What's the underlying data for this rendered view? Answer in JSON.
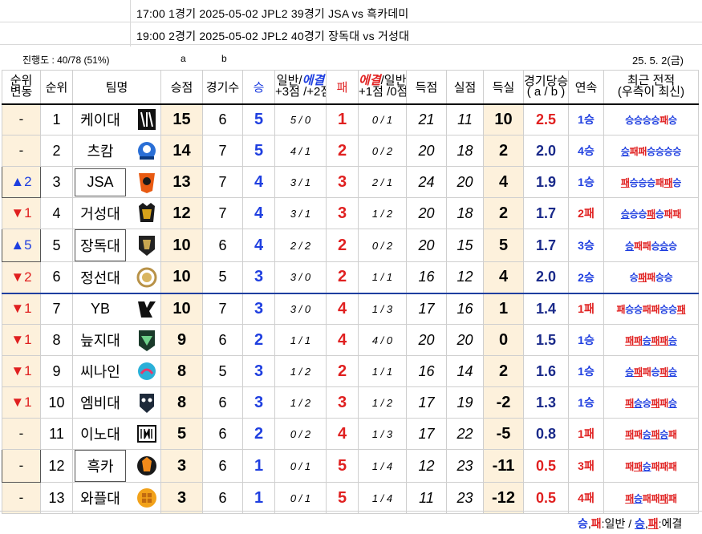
{
  "schedule": [
    {
      "text": "17:00 1경기   2025-05-02 JPL2  39경기 JSA vs 흑카데미"
    },
    {
      "text": "19:00 2경기   2025-05-02 JPL2  40경기 장독대 vs 거성대"
    }
  ],
  "progress": "진행도 : 40/78 (51%)",
  "col_a": "a",
  "col_b": "b",
  "date": "25. 5. 2(금)",
  "headers": {
    "change": [
      "순위",
      "변동"
    ],
    "rank": "순위",
    "team": "팀명",
    "points": "승점",
    "games": "경기수",
    "wins": "승",
    "win_split": {
      "normal": "일반/",
      "ext": "에결",
      "pts": "+3점 /+2점"
    },
    "losses": "패",
    "loss_split": {
      "ext": "에결",
      "normal": "/일반",
      "pts": "+1점 /0점"
    },
    "gf": "득점",
    "ga": "실점",
    "gd": "득실",
    "rate": [
      "경기당승점",
      "( a / b )"
    ],
    "streak": "연속",
    "recent": [
      "최근 전적",
      "(우측이 최신)"
    ]
  },
  "rows": [
    {
      "change": "-",
      "dir": "none",
      "rank": "1",
      "team": "케이대",
      "logo": "logo-keidae",
      "pts": "15",
      "gp": "6",
      "w": "5",
      "wsplit": "5 / 0",
      "l": "1",
      "lsplit": "0 / 1",
      "gf": "21",
      "ga": "11",
      "gd": "10",
      "rate": "2.5",
      "rate_color": "red",
      "streak": "1승",
      "streak_type": "win",
      "recent": [
        [
          "승",
          "w",
          0
        ],
        [
          "승",
          "w",
          0
        ],
        [
          "승",
          "w",
          0
        ],
        [
          "승",
          "w",
          0
        ],
        [
          "패",
          "l",
          0
        ],
        [
          "승",
          "w",
          0
        ]
      ]
    },
    {
      "change": "-",
      "dir": "none",
      "rank": "2",
      "team": "츠캄",
      "logo": "logo-tscam",
      "pts": "14",
      "gp": "7",
      "w": "5",
      "wsplit": "4 / 1",
      "l": "2",
      "lsplit": "0 / 2",
      "gf": "20",
      "ga": "18",
      "gd": "2",
      "rate": "2.0",
      "rate_color": "blue",
      "streak": "4승",
      "streak_type": "win",
      "recent": [
        [
          "승",
          "w",
          1
        ],
        [
          "패",
          "l",
          0
        ],
        [
          "패",
          "l",
          0
        ],
        [
          "승",
          "w",
          0
        ],
        [
          "승",
          "w",
          0
        ],
        [
          "승",
          "w",
          0
        ],
        [
          "승",
          "w",
          0
        ]
      ]
    },
    {
      "change": "▲2",
      "dir": "up",
      "boxed": true,
      "rank": "3",
      "team": "JSA",
      "team_boxed": true,
      "logo": "logo-jsa",
      "pts": "13",
      "gp": "7",
      "w": "4",
      "wsplit": "3 / 1",
      "l": "3",
      "lsplit": "2 / 1",
      "gf": "24",
      "ga": "20",
      "gd": "4",
      "rate": "1.9",
      "rate_color": "blue",
      "streak": "1승",
      "streak_type": "win",
      "recent": [
        [
          "패",
          "l",
          1
        ],
        [
          "승",
          "w",
          0
        ],
        [
          "승",
          "w",
          0
        ],
        [
          "승",
          "w",
          0
        ],
        [
          "패",
          "l",
          0
        ],
        [
          "패",
          "l",
          1
        ],
        [
          "승",
          "w",
          0
        ]
      ]
    },
    {
      "change": "▼1",
      "dir": "down",
      "rank": "4",
      "team": "거성대",
      "logo": "logo-geosung",
      "pts": "12",
      "gp": "7",
      "w": "4",
      "wsplit": "3 / 1",
      "l": "3",
      "lsplit": "1 / 2",
      "gf": "20",
      "ga": "18",
      "gd": "2",
      "rate": "1.7",
      "rate_color": "blue",
      "streak": "2패",
      "streak_type": "loss",
      "recent": [
        [
          "승",
          "w",
          1
        ],
        [
          "승",
          "w",
          0
        ],
        [
          "승",
          "w",
          0
        ],
        [
          "패",
          "l",
          1
        ],
        [
          "승",
          "w",
          0
        ],
        [
          "패",
          "l",
          0
        ],
        [
          "패",
          "l",
          0
        ]
      ]
    },
    {
      "change": "▲5",
      "dir": "up",
      "boxed": true,
      "rank": "5",
      "team": "장독대",
      "team_boxed": true,
      "logo": "logo-jangdok",
      "pts": "10",
      "gp": "6",
      "w": "4",
      "wsplit": "2 / 2",
      "l": "2",
      "lsplit": "0 / 2",
      "gf": "20",
      "ga": "15",
      "gd": "5",
      "rate": "1.7",
      "rate_color": "blue",
      "streak": "3승",
      "streak_type": "win",
      "recent": [
        [
          "승",
          "w",
          1
        ],
        [
          "패",
          "l",
          0
        ],
        [
          "패",
          "l",
          0
        ],
        [
          "승",
          "w",
          0
        ],
        [
          "승",
          "w",
          1
        ],
        [
          "승",
          "w",
          0
        ]
      ]
    },
    {
      "change": "▼2",
      "dir": "down",
      "rank": "6",
      "team": "정선대",
      "logo": "logo-jungsun",
      "pts": "10",
      "gp": "5",
      "w": "3",
      "wsplit": "3 / 0",
      "l": "2",
      "lsplit": "1 / 1",
      "gf": "16",
      "ga": "12",
      "gd": "4",
      "rate": "2.0",
      "rate_color": "blue",
      "streak": "2승",
      "streak_type": "win",
      "split": true,
      "recent": [
        [
          "승",
          "w",
          0
        ],
        [
          "패",
          "l",
          1
        ],
        [
          "패",
          "l",
          0
        ],
        [
          "승",
          "w",
          0
        ],
        [
          "승",
          "w",
          0
        ]
      ]
    },
    {
      "change": "▼1",
      "dir": "down",
      "rank": "7",
      "team": "YB",
      "logo": "logo-yb",
      "pts": "10",
      "gp": "7",
      "w": "3",
      "wsplit": "3 / 0",
      "l": "4",
      "lsplit": "1 / 3",
      "gf": "17",
      "ga": "16",
      "gd": "1",
      "rate": "1.4",
      "rate_color": "blue",
      "streak": "1패",
      "streak_type": "loss",
      "recent": [
        [
          "패",
          "l",
          0
        ],
        [
          "승",
          "w",
          0
        ],
        [
          "승",
          "w",
          0
        ],
        [
          "패",
          "l",
          0
        ],
        [
          "패",
          "l",
          0
        ],
        [
          "승",
          "w",
          0
        ],
        [
          "승",
          "w",
          0
        ],
        [
          "패",
          "l",
          1
        ]
      ]
    },
    {
      "change": "▼1",
      "dir": "down",
      "rank": "8",
      "team": "늪지대",
      "logo": "logo-neupji",
      "pts": "9",
      "gp": "6",
      "w": "2",
      "wsplit": "1 / 1",
      "l": "4",
      "lsplit": "4 / 0",
      "gf": "20",
      "ga": "20",
      "gd": "0",
      "rate": "1.5",
      "rate_color": "blue",
      "streak": "1승",
      "streak_type": "win",
      "recent": [
        [
          "패",
          "l",
          1
        ],
        [
          "패",
          "l",
          1
        ],
        [
          "승",
          "w",
          1
        ],
        [
          "패",
          "l",
          1
        ],
        [
          "패",
          "l",
          1
        ],
        [
          "승",
          "w",
          1
        ]
      ]
    },
    {
      "change": "▼1",
      "dir": "down",
      "rank": "9",
      "team": "씨나인",
      "logo": "logo-c9",
      "pts": "8",
      "gp": "5",
      "w": "3",
      "wsplit": "1 / 2",
      "l": "2",
      "lsplit": "1 / 1",
      "gf": "16",
      "ga": "14",
      "gd": "2",
      "rate": "1.6",
      "rate_color": "blue",
      "streak": "1승",
      "streak_type": "win",
      "recent": [
        [
          "승",
          "w",
          1
        ],
        [
          "패",
          "l",
          1
        ],
        [
          "패",
          "l",
          0
        ],
        [
          "승",
          "w",
          0
        ],
        [
          "패",
          "l",
          1
        ],
        [
          "승",
          "w",
          1
        ]
      ]
    },
    {
      "change": "▼1",
      "dir": "down",
      "rank": "10",
      "team": "엠비대",
      "logo": "logo-mbi",
      "pts": "8",
      "gp": "6",
      "w": "3",
      "wsplit": "1 / 2",
      "l": "3",
      "lsplit": "1 / 2",
      "gf": "17",
      "ga": "19",
      "gd": "-2",
      "rate": "1.3",
      "rate_color": "blue",
      "streak": "1승",
      "streak_type": "win",
      "recent": [
        [
          "패",
          "l",
          1
        ],
        [
          "승",
          "w",
          1
        ],
        [
          "승",
          "w",
          0
        ],
        [
          "패",
          "l",
          1
        ],
        [
          "패",
          "l",
          0
        ],
        [
          "승",
          "w",
          1
        ]
      ]
    },
    {
      "change": "-",
      "dir": "none",
      "rank": "11",
      "team": "이노대",
      "logo": "logo-ino",
      "pts": "5",
      "gp": "6",
      "w": "2",
      "wsplit": "0 / 2",
      "l": "4",
      "lsplit": "1 / 3",
      "gf": "17",
      "ga": "22",
      "gd": "-5",
      "rate": "0.8",
      "rate_color": "blue",
      "streak": "1패",
      "streak_type": "loss",
      "recent": [
        [
          "패",
          "l",
          1
        ],
        [
          "패",
          "l",
          0
        ],
        [
          "승",
          "w",
          1
        ],
        [
          "패",
          "l",
          1
        ],
        [
          "승",
          "w",
          1
        ],
        [
          "패",
          "l",
          0
        ]
      ]
    },
    {
      "change": "-",
      "dir": "none",
      "boxed": true,
      "rank": "12",
      "team": "흑카",
      "team_boxed": true,
      "logo": "logo-heukka",
      "pts": "3",
      "gp": "6",
      "w": "1",
      "wsplit": "0 / 1",
      "l": "5",
      "lsplit": "1 / 4",
      "gf": "12",
      "ga": "23",
      "gd": "-11",
      "rate": "0.5",
      "rate_color": "red",
      "streak": "3패",
      "streak_type": "loss",
      "recent": [
        [
          "패",
          "l",
          0
        ],
        [
          "패",
          "l",
          1
        ],
        [
          "승",
          "w",
          1
        ],
        [
          "패",
          "l",
          0
        ],
        [
          "패",
          "l",
          0
        ],
        [
          "패",
          "l",
          0
        ]
      ]
    },
    {
      "change": "-",
      "dir": "none",
      "rank": "13",
      "team": "와플대",
      "logo": "logo-waffle",
      "pts": "3",
      "gp": "6",
      "w": "1",
      "wsplit": "0 / 1",
      "l": "5",
      "lsplit": "1 / 4",
      "gf": "11",
      "ga": "23",
      "gd": "-12",
      "rate": "0.5",
      "rate_color": "red",
      "streak": "4패",
      "streak_type": "loss",
      "recent": [
        [
          "패",
          "l",
          1
        ],
        [
          "승",
          "w",
          1
        ],
        [
          "패",
          "l",
          0
        ],
        [
          "패",
          "l",
          0
        ],
        [
          "패",
          "l",
          1
        ],
        [
          "패",
          "l",
          0
        ]
      ]
    }
  ],
  "legend": {
    "win": "승",
    "sep1": ",",
    "loss": "패",
    "normal": ":일반 / ",
    "uwin": "승",
    "sep2": ",",
    "uloss": "패",
    "ext": ":에결"
  },
  "colors": {
    "win_blue": "#1f3fe0",
    "loss_red": "#e02020",
    "highlight": "#fdf1dc"
  }
}
